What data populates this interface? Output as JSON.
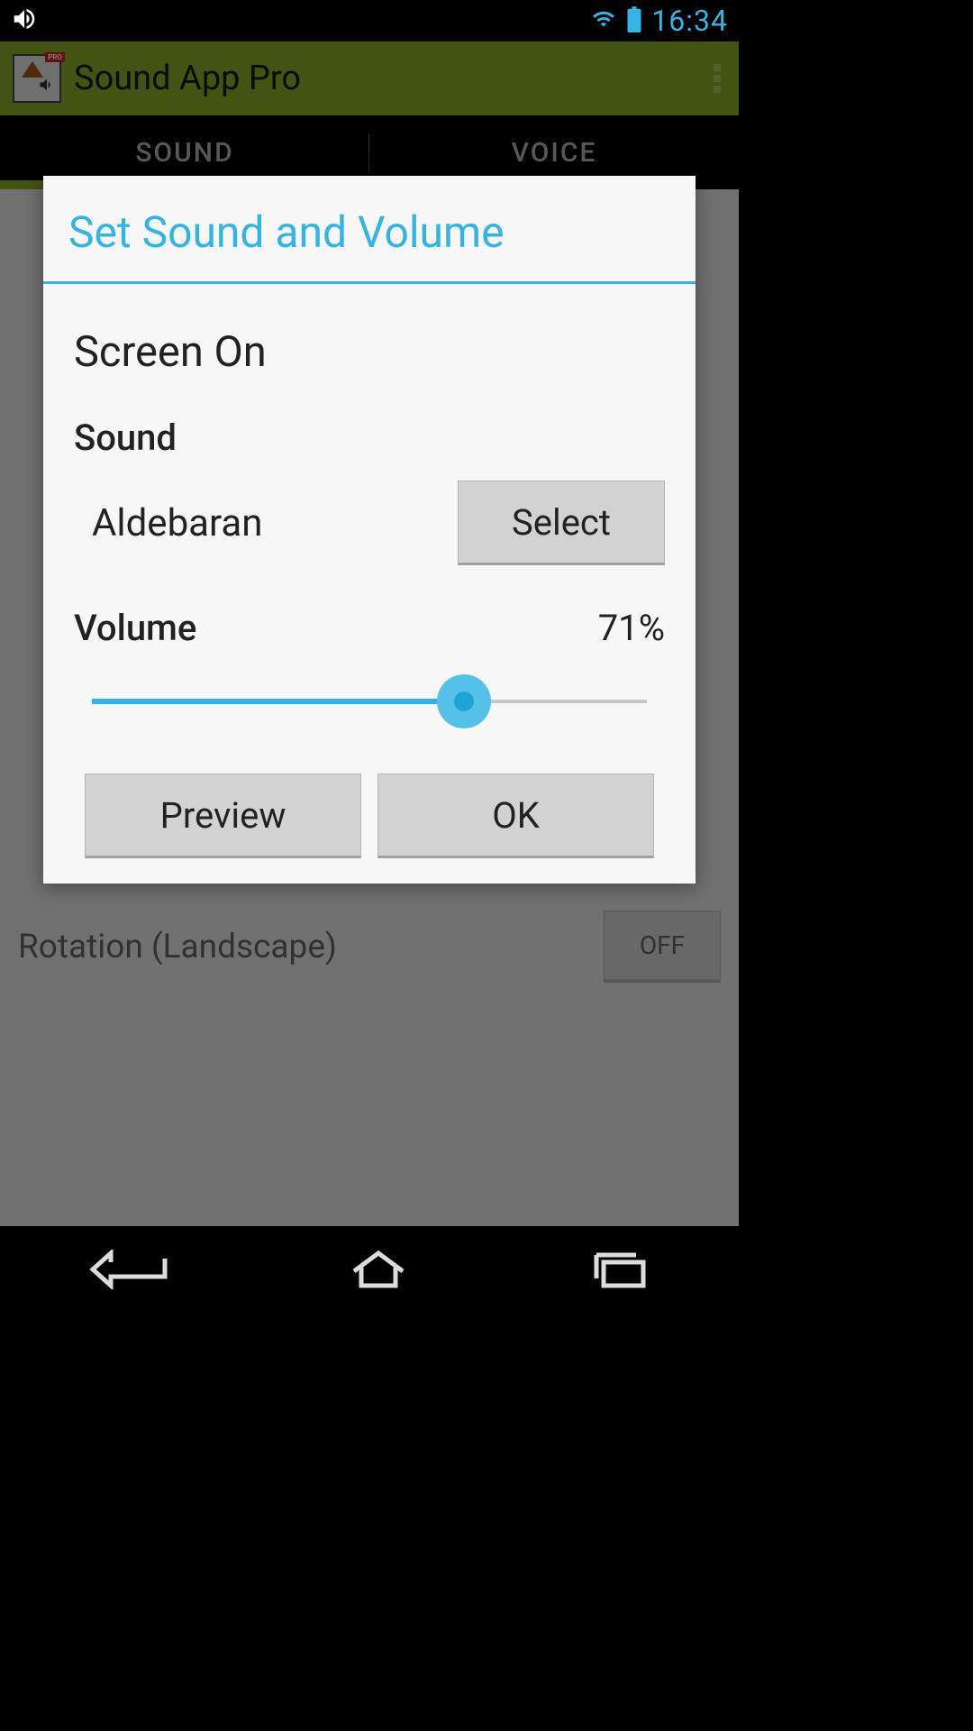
{
  "status": {
    "clock": "16:34"
  },
  "app": {
    "title": "Sound App Pro",
    "icon_badge": "PRO"
  },
  "tabs": {
    "sound": "SOUND",
    "voice": "VOICE"
  },
  "background_list": {
    "rotation_label": "Rotation (Landscape)",
    "rotation_state": "OFF"
  },
  "dialog": {
    "title": "Set Sound and Volume",
    "context": "Screen On",
    "sound_section": "Sound",
    "sound_value": "Aldebaran",
    "select_label": "Select",
    "volume_section": "Volume",
    "volume_value": "71%",
    "slider_percent": 71,
    "preview_label": "Preview",
    "ok_label": "OK"
  }
}
